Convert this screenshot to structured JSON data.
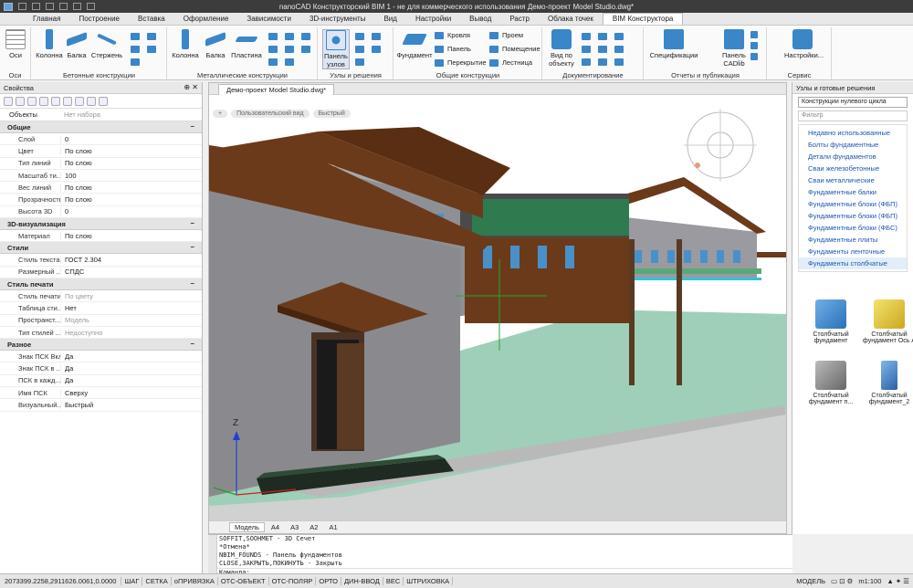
{
  "window": {
    "title": "nanoCAD Конструкторский BIM 1 - не для коммерческого использования Демо-проект Model Studio.dwg*"
  },
  "menu": {
    "tabs": [
      "Главная",
      "Построение",
      "Вставка",
      "Оформление",
      "Зависимости",
      "3D-инструменты",
      "Вид",
      "Настройки",
      "Вывод",
      "Растр",
      "Облака точек",
      "BIM Конструктора"
    ],
    "active": "BIM Конструктора"
  },
  "ribbon": {
    "groups": {
      "axes": "Оси",
      "concrete": "Бетонные конструкции",
      "metal": "Металлические конструкции",
      "nodes": "Узлы и решения",
      "common": "Общие конструкции",
      "docs": "Документирование",
      "reports": "Отчеты и публикация",
      "service": "Сервис"
    },
    "buttons": {
      "axes": "Оси",
      "column": "Колонна",
      "beam": "Балка",
      "rod": "Стержень",
      "column_m": "Колонна",
      "beam_m": "Балка",
      "plate": "Пластина",
      "nodes_panel": "Панель узлов",
      "foundation": "Фундамент",
      "roof": "Кровля",
      "panel": "Панель",
      "floor": "Перекрытие",
      "opening": "Проем",
      "room": "Помещение",
      "stair": "Лестница",
      "view_obj": "Вид по объекту",
      "specs": "Спецификации",
      "cadlib_panel": "Панель CADlib",
      "settings": "Настройки..."
    }
  },
  "properties": {
    "header": "Свойства",
    "objects_label": "Объекты",
    "objects_value": "Нет набора",
    "sections": [
      {
        "title": "Общие",
        "rows": [
          {
            "k": "Слой",
            "v": "0"
          },
          {
            "k": "Цвет",
            "v": "По слою"
          },
          {
            "k": "Тип линий",
            "v": "По слою"
          },
          {
            "k": "Масштаб ти...",
            "v": "100"
          },
          {
            "k": "Вес линий",
            "v": "По слою"
          },
          {
            "k": "Прозрачность",
            "v": "По слою"
          },
          {
            "k": "Высота 3D",
            "v": "0"
          }
        ]
      },
      {
        "title": "3D-визуализация",
        "rows": [
          {
            "k": "Материал",
            "v": "По слою"
          }
        ]
      },
      {
        "title": "Стили",
        "rows": [
          {
            "k": "Стиль текста",
            "v": "ГОСТ 2.304"
          },
          {
            "k": "Размерный ...",
            "v": "СПДС"
          }
        ]
      },
      {
        "title": "Стиль печати",
        "rows": [
          {
            "k": "Стиль печати",
            "v": "По цвету",
            "dim": true
          },
          {
            "k": "Таблица сти...",
            "v": "Нет"
          },
          {
            "k": "Пространст...",
            "v": "Модель",
            "dim": true
          },
          {
            "k": "Тип стилей ...",
            "v": "Недоступно",
            "dim": true
          }
        ]
      },
      {
        "title": "Разное",
        "rows": [
          {
            "k": "Знак ПСК Вкл",
            "v": "Да"
          },
          {
            "k": "Знак ПСК в ...",
            "v": "Да"
          },
          {
            "k": "ПСК в кажд...",
            "v": "Да"
          },
          {
            "k": "Имя ПСК",
            "v": "Сверху"
          },
          {
            "k": "Визуальный...",
            "v": "Быстрый"
          }
        ]
      }
    ]
  },
  "document": {
    "tab": "Демо-проект Model Studio.dwg*",
    "view_controls": [
      "Пользовательский вид",
      "Быстрый"
    ],
    "axis_z": "Z",
    "model_tabs": [
      "Модель",
      "A4",
      "A3",
      "A2",
      "A1"
    ],
    "active_model_tab": "Модель"
  },
  "right_panel": {
    "header": "Узлы и готовые решения",
    "combo": "Конструкции нулевого цикла",
    "filter_placeholder": "Фильтр",
    "items": [
      "Недавно использованные",
      "Болты фундаментные",
      "Детали фундаментов",
      "Сваи железобетонные",
      "Сваи металлические",
      "Фундаментные балки",
      "Фундаментные блоки (ФБП)",
      "Фундаментные блоки (ФБП)",
      "Фундаментные блоки (ФБС)",
      "Фундаментные плиты",
      "Фундаменты ленточные",
      "Фундаменты столбчатые"
    ],
    "selected": "Фундаменты столбчатые",
    "tiles": [
      "Столбчатый фундамент",
      "Столбчатый фундамент Ось А",
      "Столбчатый фундамент п...",
      "Столбчатый фундамент_2"
    ]
  },
  "command": {
    "side_label": "Кома...",
    "lines": [
      "SOFFIT,SOOHMET - 3D Сечет",
      "*Отмена*",
      "NBIM_FOUNDS - Панель фундаментов",
      "CLOSE,ЗАКРЫТЬ,ПОКИНУТЬ - Закрыть",
      "Команда:"
    ]
  },
  "status": {
    "coords": "2073399.2258,2911626.0061,0.0000",
    "toggles": [
      "ШАГ",
      "СЕТКА",
      "оПРИВЯЗКА",
      "ОТС-ОБЪЕКТ",
      "ОТС-ПОЛЯР",
      "ОРТО",
      "ДИН-ВВОД",
      "ВЕС",
      "ШТРИХОВКА"
    ],
    "model": "МОДЕЛЬ",
    "scale": "m1:100"
  },
  "colors": {
    "accent": "#3a86c8",
    "roof": "#6b3a1a",
    "wall": "#8a8a8e",
    "ground": "#cfd2d0",
    "green_plane": "#7fc6a6",
    "sign": "#2f7a4f"
  }
}
